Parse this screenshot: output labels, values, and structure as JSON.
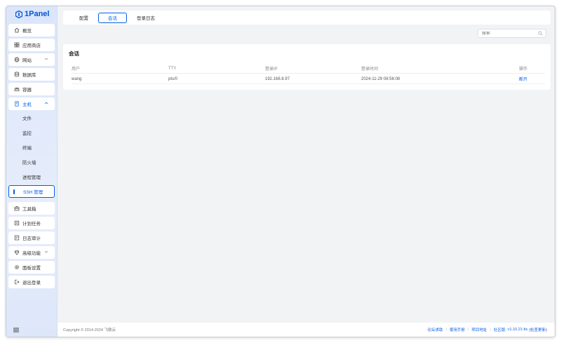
{
  "app": {
    "name": "1Panel"
  },
  "sidebar": {
    "items": [
      {
        "label": "概览",
        "icon": "home-icon"
      },
      {
        "label": "应用商店",
        "icon": "grid-icon"
      },
      {
        "label": "网站",
        "icon": "globe-icon"
      },
      {
        "label": "数据库",
        "icon": "database-icon"
      },
      {
        "label": "容器",
        "icon": "container-icon"
      },
      {
        "label": "主机",
        "icon": "host-icon"
      }
    ],
    "host_subitems": [
      "文件",
      "监控",
      "终端",
      "防火墙",
      "进程管理",
      "SSH 管理"
    ],
    "items_after": [
      {
        "label": "工具箱",
        "icon": "toolbox-icon"
      },
      {
        "label": "计划任务",
        "icon": "schedule-icon"
      },
      {
        "label": "日志审计",
        "icon": "log-icon"
      },
      {
        "label": "高级功能",
        "icon": "diamond-icon"
      },
      {
        "label": "面板设置",
        "icon": "gear-icon"
      },
      {
        "label": "退出登录",
        "icon": "logout-icon"
      }
    ]
  },
  "tabs": [
    "配置",
    "会话",
    "登录日志"
  ],
  "search": {
    "placeholder": "搜索"
  },
  "sessions": {
    "title": "会话",
    "columns": [
      "用户",
      "TTY",
      "登录IP",
      "登录时间",
      "操作"
    ],
    "rows": [
      {
        "user": "wang",
        "tty": "pts/0",
        "ip": "192.168.8.97",
        "time": "2024-11-29 08:56:08",
        "action": "断开"
      }
    ]
  },
  "footer": {
    "copyright": "Copyright © 2014-2024 飞致云",
    "links": [
      "论坛求助",
      "使用手册",
      "项目地址"
    ],
    "community": "社区版:",
    "version": "v1.10.21-lts",
    "check_update": "(检查更新)"
  },
  "colors": {
    "accent": "#005eeb",
    "sidebar_bg": "#dbe6fb",
    "page_bg": "#f2f3f5"
  }
}
